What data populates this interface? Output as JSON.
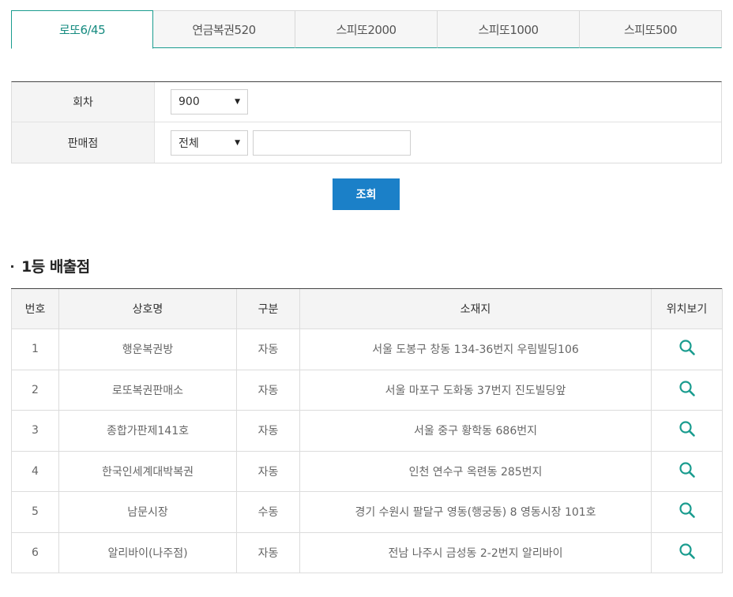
{
  "tabs": [
    {
      "label": "로또6/45",
      "active": true
    },
    {
      "label": "연금복권520",
      "active": false
    },
    {
      "label": "스피또2000",
      "active": false
    },
    {
      "label": "스피또1000",
      "active": false
    },
    {
      "label": "스피또500",
      "active": false
    }
  ],
  "form": {
    "round_label": "회차",
    "round_value": "900",
    "store_label": "판매점",
    "store_region_value": "전체",
    "store_name_value": ""
  },
  "search_button": "조회",
  "section_title": "1등 배출점",
  "table": {
    "headers": [
      "번호",
      "상호명",
      "구분",
      "소재지",
      "위치보기"
    ],
    "rows": [
      {
        "no": "1",
        "name": "행운복권방",
        "type": "자동",
        "address": "서울 도봉구 창동 134-36번지 우림빌딩106"
      },
      {
        "no": "2",
        "name": "로또복권판매소",
        "type": "자동",
        "address": "서울 마포구 도화동 37번지 진도빌딩앞"
      },
      {
        "no": "3",
        "name": "종합가판제141호",
        "type": "자동",
        "address": "서울 중구 황학동 686번지"
      },
      {
        "no": "4",
        "name": "한국인세계대박복권",
        "type": "자동",
        "address": "인천 연수구 옥련동 285번지"
      },
      {
        "no": "5",
        "name": "남문시장",
        "type": "수동",
        "address": "경기 수원시 팔달구 영동(행궁동) 8 영동시장 101호"
      },
      {
        "no": "6",
        "name": "알리바이(나주점)",
        "type": "자동",
        "address": "전남 나주시 금성동 2-2번지 알리바이"
      }
    ]
  },
  "colors": {
    "accent": "#1a9c8f",
    "button": "#1b80c8"
  },
  "icons": {
    "location": "search-icon",
    "dropdown": "caret-down-icon"
  }
}
